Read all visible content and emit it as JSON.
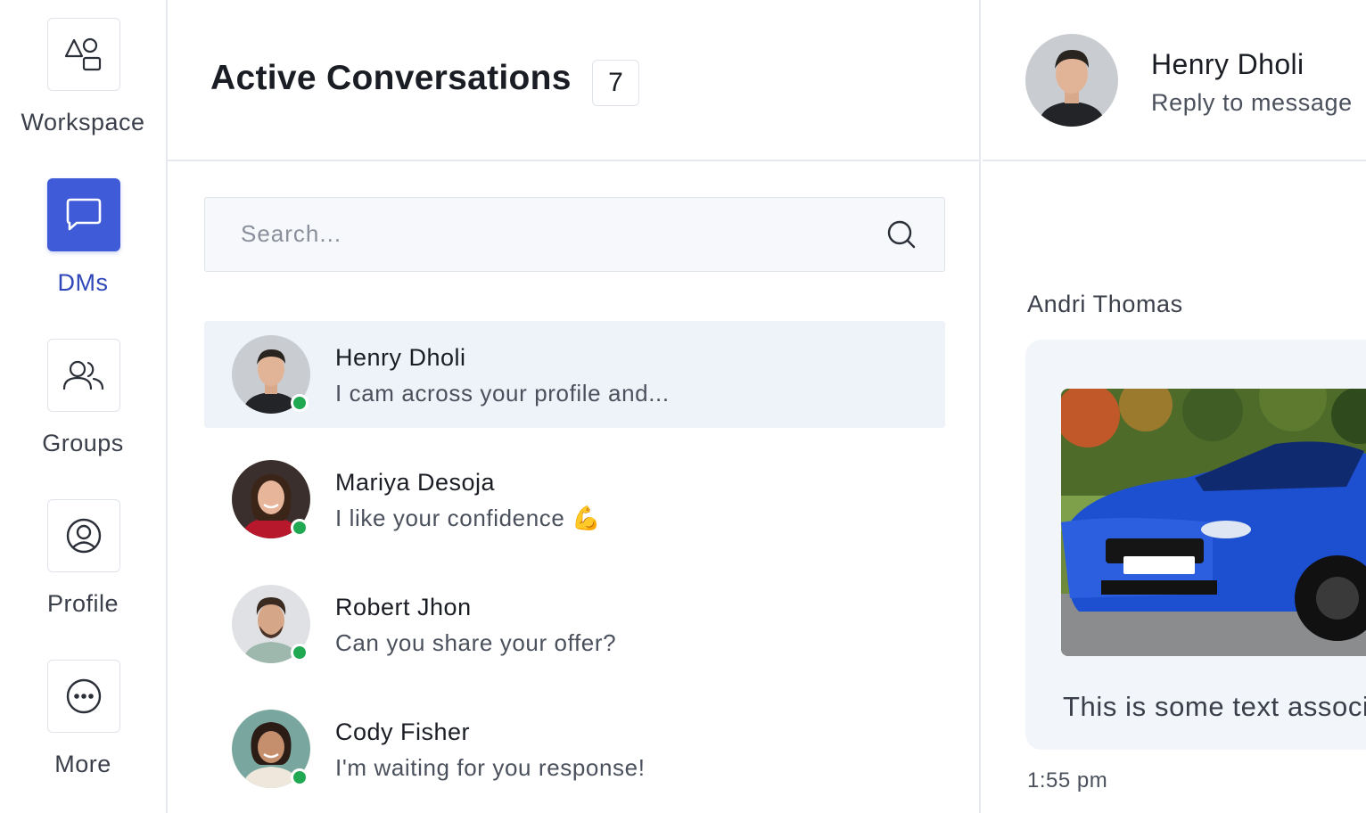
{
  "sidebar": {
    "items": [
      {
        "label": "Workspace",
        "icon": "shapes-icon",
        "active": false
      },
      {
        "label": "DMs",
        "icon": "chat-bubble-icon",
        "active": true
      },
      {
        "label": "Groups",
        "icon": "users-icon",
        "active": false
      },
      {
        "label": "Profile",
        "icon": "user-circle-icon",
        "active": false
      },
      {
        "label": "More",
        "icon": "more-dots-icon",
        "active": false
      }
    ],
    "accent_color": "#3f5bd8"
  },
  "conversations": {
    "title": "Active Conversations",
    "count": "7",
    "search": {
      "placeholder": "Search..."
    },
    "items": [
      {
        "name": "Henry Dholi",
        "preview": "I cam across your profile and...",
        "online": true,
        "selected": true
      },
      {
        "name": "Mariya Desoja",
        "preview": "I like your confidence 💪",
        "online": true,
        "selected": false
      },
      {
        "name": "Robert Jhon",
        "preview": "Can you share your offer?",
        "online": true,
        "selected": false
      },
      {
        "name": "Cody Fisher",
        "preview": "I'm waiting for you response!",
        "online": true,
        "selected": false
      }
    ]
  },
  "chat": {
    "header": {
      "name": "Henry Dholi",
      "subtitle": "Reply to message"
    },
    "message": {
      "sender": "Andri Thomas",
      "text": "This is some text associated with the image",
      "time": "1:55 pm"
    }
  },
  "colors": {
    "online": "#20a852",
    "selected_row": "#eef2f9",
    "border": "#e6e9ef"
  }
}
